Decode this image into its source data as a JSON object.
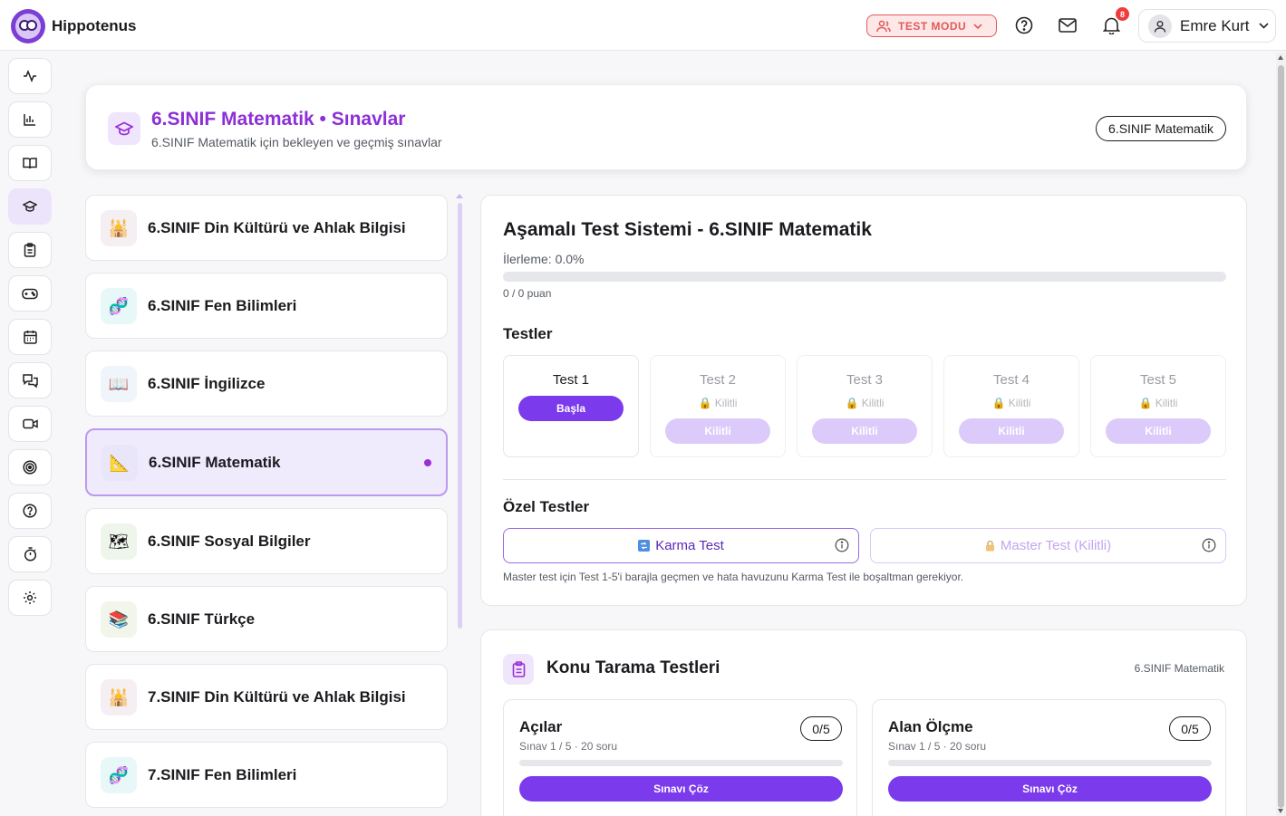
{
  "app": {
    "brand": "Hippotenus"
  },
  "topbar": {
    "test_mode_label": "TEST MODU",
    "notification_count": "8",
    "user_name": "Emre Kurt"
  },
  "header": {
    "title": "6.SINIF Matematik • Sınavlar",
    "subtitle": "6.SINIF Matematik için bekleyen ve geçmiş sınavlar",
    "pill": "6.SINIF Matematik"
  },
  "subjects": [
    {
      "label": "6.SINIF Din Kültürü ve Ahlak Bilgisi",
      "emoji": "🕌",
      "active": false
    },
    {
      "label": "6.SINIF Fen Bilimleri",
      "emoji": "🧬",
      "active": false
    },
    {
      "label": "6.SINIF İngilizce",
      "emoji": "📖",
      "active": false
    },
    {
      "label": "6.SINIF Matematik",
      "emoji": "📐",
      "active": true
    },
    {
      "label": "6.SINIF Sosyal Bilgiler",
      "emoji": "🗺",
      "active": false
    },
    {
      "label": "6.SINIF Türkçe",
      "emoji": "📚",
      "active": false
    },
    {
      "label": "7.SINIF Din Kültürü ve Ahlak Bilgisi",
      "emoji": "🕌",
      "active": false
    },
    {
      "label": "7.SINIF Fen Bilimleri",
      "emoji": "🧬",
      "active": false
    }
  ],
  "test_system": {
    "title": "Aşamalı Test Sistemi - 6.SINIF Matematik",
    "progress_label": "İlerleme: 0.0%",
    "progress_fraction": 0,
    "points_label": "0 / 0 puan",
    "tests_heading": "Testler",
    "tests": [
      {
        "name": "Test 1",
        "button": "Başla",
        "locked": false,
        "lock_text": ""
      },
      {
        "name": "Test 2",
        "button": "Kilitli",
        "locked": true,
        "lock_text": "🔒 Kilitli"
      },
      {
        "name": "Test 3",
        "button": "Kilitli",
        "locked": true,
        "lock_text": "🔒 Kilitli"
      },
      {
        "name": "Test 4",
        "button": "Kilitli",
        "locked": true,
        "lock_text": "🔒 Kilitli"
      },
      {
        "name": "Test 5",
        "button": "Kilitli",
        "locked": true,
        "lock_text": "🔒 Kilitli"
      }
    ],
    "special_heading": "Özel Testler",
    "karma_label": "Karma Test",
    "master_label": "Master Test (Kilitli)",
    "note": "Master test için Test 1-5'i barajla geçmen ve hata havuzunu Karma Test ile boşaltman gerekiyor."
  },
  "topic_scan": {
    "title": "Konu Tarama Testleri",
    "tag": "6.SINIF Matematik",
    "topics": [
      {
        "name": "Açılar",
        "meta": "Sınav 1 / 5 · 20 soru",
        "score": "0/5",
        "progress_fraction": 0,
        "button": "Sınavı Çöz"
      },
      {
        "name": "Alan Ölçme",
        "meta": "Sınav 1 / 5 · 20 soru",
        "score": "0/5",
        "progress_fraction": 0,
        "button": "Sınavı Çöz"
      }
    ]
  },
  "colors": {
    "accent": "#7c3aed",
    "title_purple": "#8d2fd7",
    "danger": "#e05a5a"
  }
}
